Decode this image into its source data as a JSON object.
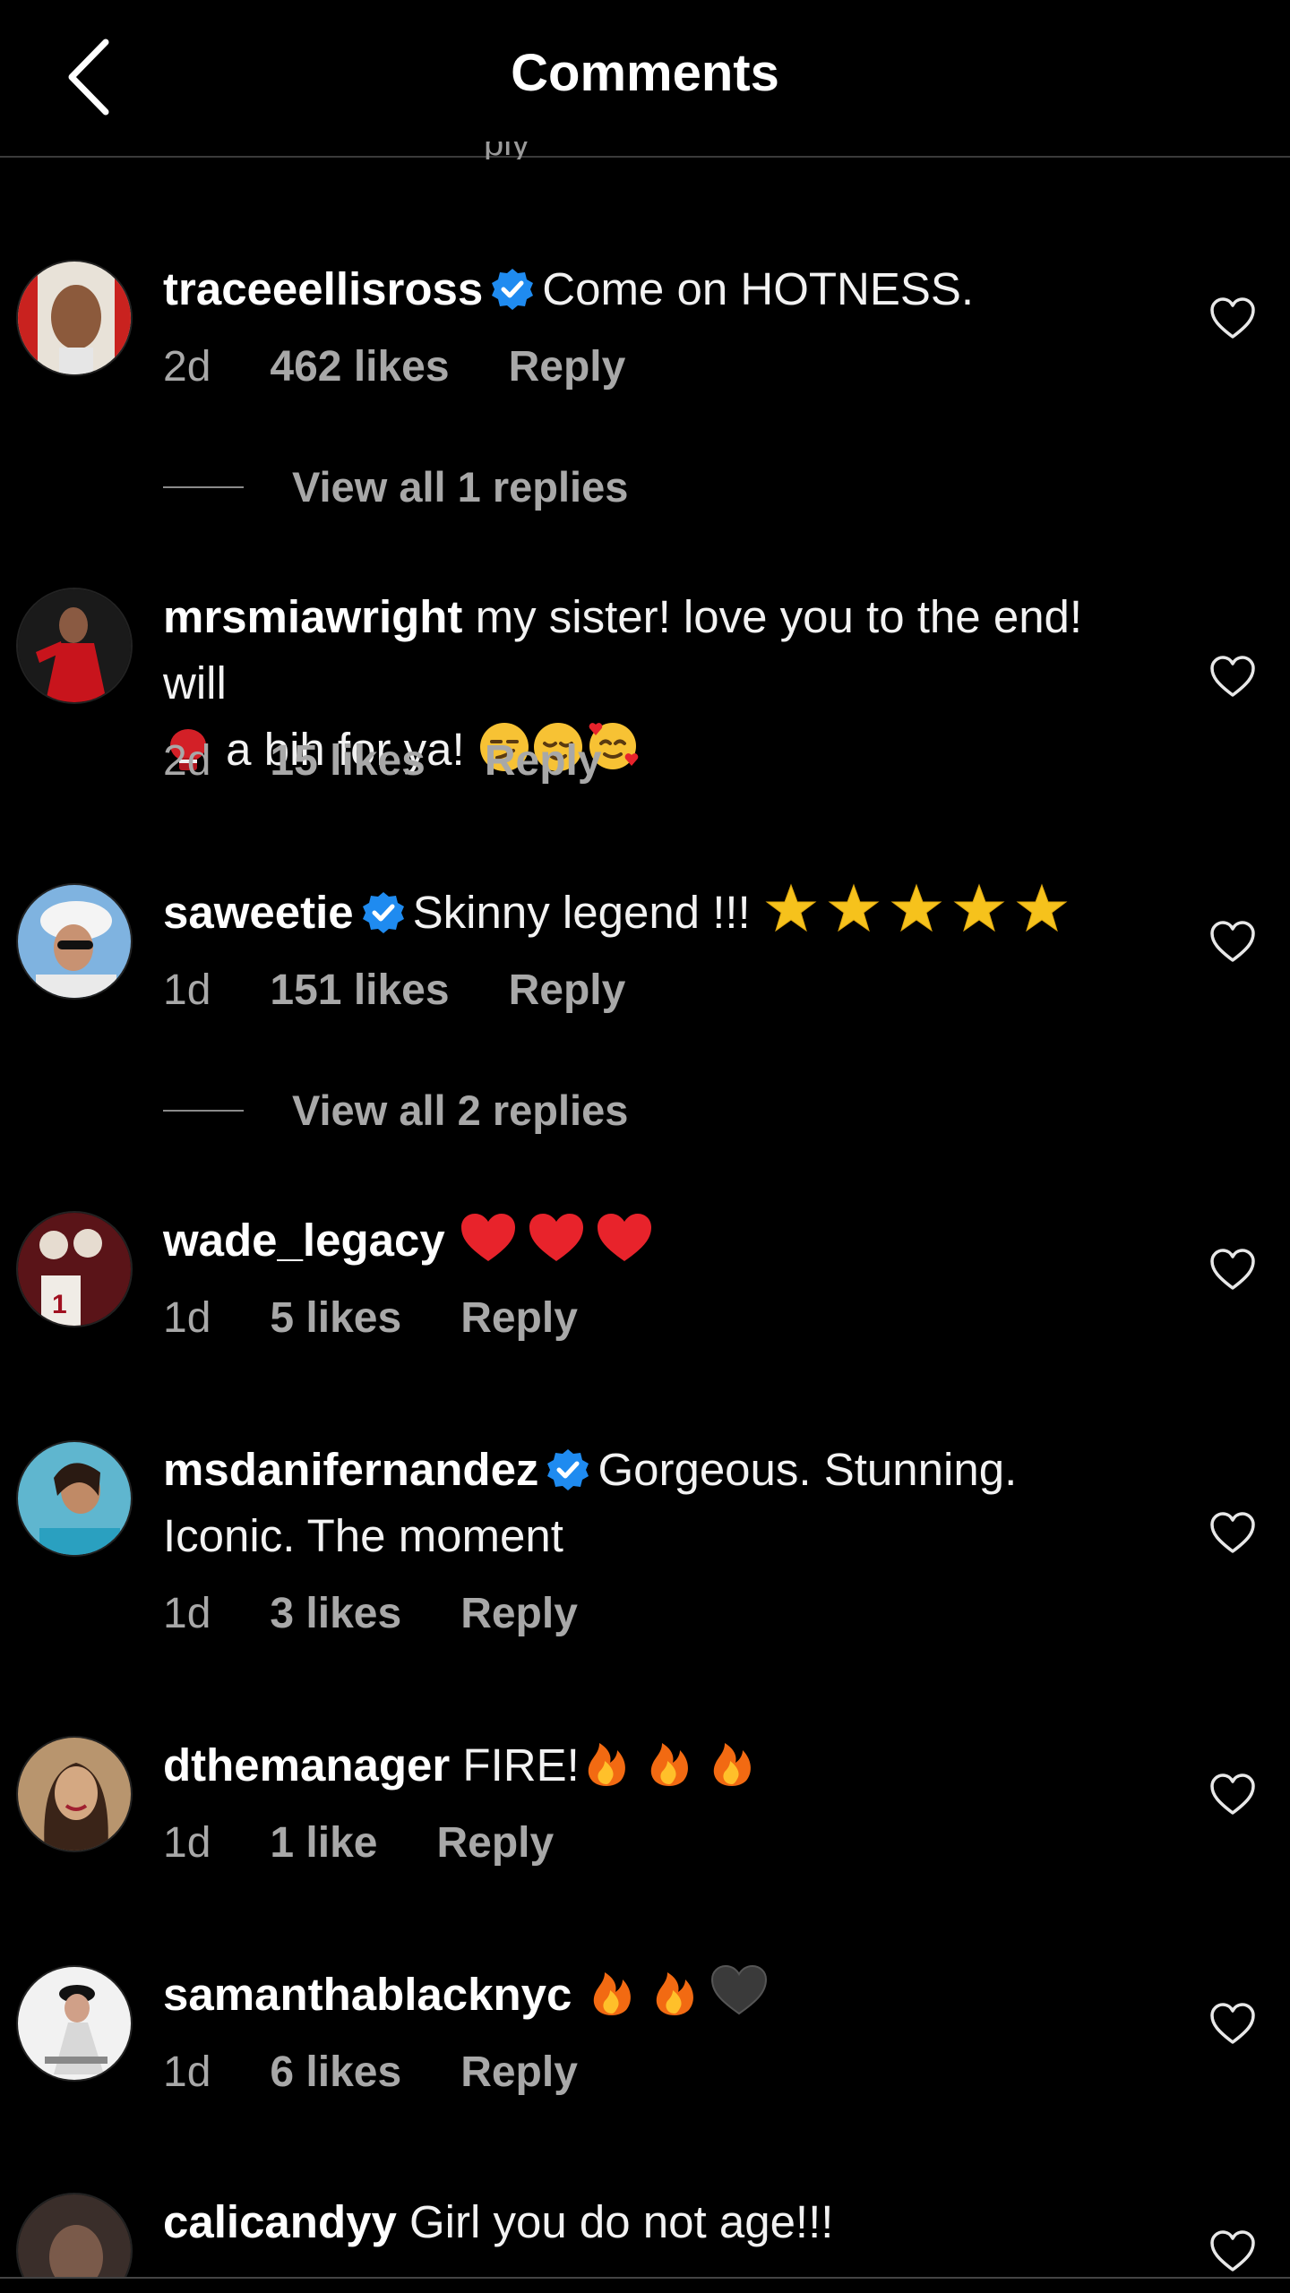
{
  "header": {
    "title": "Comments",
    "clipped_text": "ply"
  },
  "comments": [
    {
      "username": "traceeellisross",
      "verified": true,
      "text": "Come on HOTNESS.",
      "time": "2d",
      "likes": "462 likes",
      "reply": "Reply",
      "replies": "View all 1 replies"
    },
    {
      "username": "mrsmiawright",
      "verified": false,
      "text": "my sister! love you to the end! will",
      "text2": "a bih for ya!",
      "time": "2d",
      "likes": "15 likes",
      "reply": "Reply"
    },
    {
      "username": "saweetie",
      "verified": true,
      "text": "Skinny legend !!!",
      "time": "1d",
      "likes": "151 likes",
      "reply": "Reply",
      "replies": "View all 2 replies"
    },
    {
      "username": "wade_legacy",
      "verified": false,
      "text": "",
      "time": "1d",
      "likes": "5 likes",
      "reply": "Reply"
    },
    {
      "username": "msdanifernandez",
      "verified": true,
      "text": "Gorgeous. Stunning.",
      "text2": "Iconic. The moment",
      "time": "1d",
      "likes": "3 likes",
      "reply": "Reply"
    },
    {
      "username": "dthemanager",
      "verified": false,
      "text": "FIRE!",
      "time": "1d",
      "likes": "1 like",
      "reply": "Reply"
    },
    {
      "username": "samanthablacknyc",
      "verified": false,
      "text": "",
      "time": "1d",
      "likes": "6 likes",
      "reply": "Reply"
    },
    {
      "username": "calicandyy",
      "verified": false,
      "text": "Girl you do not age!!!"
    }
  ],
  "icons": {
    "back": "chevron-left-icon",
    "verified": "verified-badge-icon",
    "like": "heart-outline-icon"
  },
  "colors": {
    "background": "#000000",
    "verified": "#1f8bf0",
    "secondary_text": "#a8a8a8"
  }
}
